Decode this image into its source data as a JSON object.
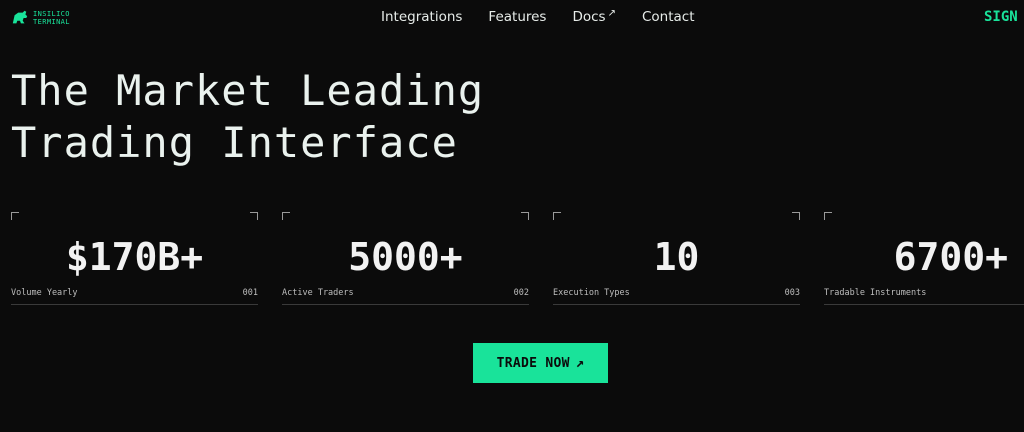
{
  "brand": {
    "line1": "INSILICO",
    "line2": "TERMINAL",
    "accent_color": "#19e39a",
    "logo_icon": "bull-icon"
  },
  "nav": {
    "items": [
      {
        "label": "Integrations"
      },
      {
        "label": "Features"
      },
      {
        "label": "Docs",
        "external_icon": "↗"
      },
      {
        "label": "Contact"
      }
    ]
  },
  "header": {
    "sign_label": "SIGN"
  },
  "hero": {
    "line1": "The Market Leading",
    "line2": "Trading Interface"
  },
  "stats": [
    {
      "value": "$170B+",
      "label": "Volume Yearly",
      "index": "001"
    },
    {
      "value": "5000+",
      "label": "Active Traders",
      "index": "002"
    },
    {
      "value": "10",
      "label": "Execution Types",
      "index": "003"
    },
    {
      "value": "6700+",
      "label": "Tradable Instruments",
      "index": ""
    }
  ],
  "cta": {
    "label": "TRADE NOW",
    "icon": "↗"
  }
}
